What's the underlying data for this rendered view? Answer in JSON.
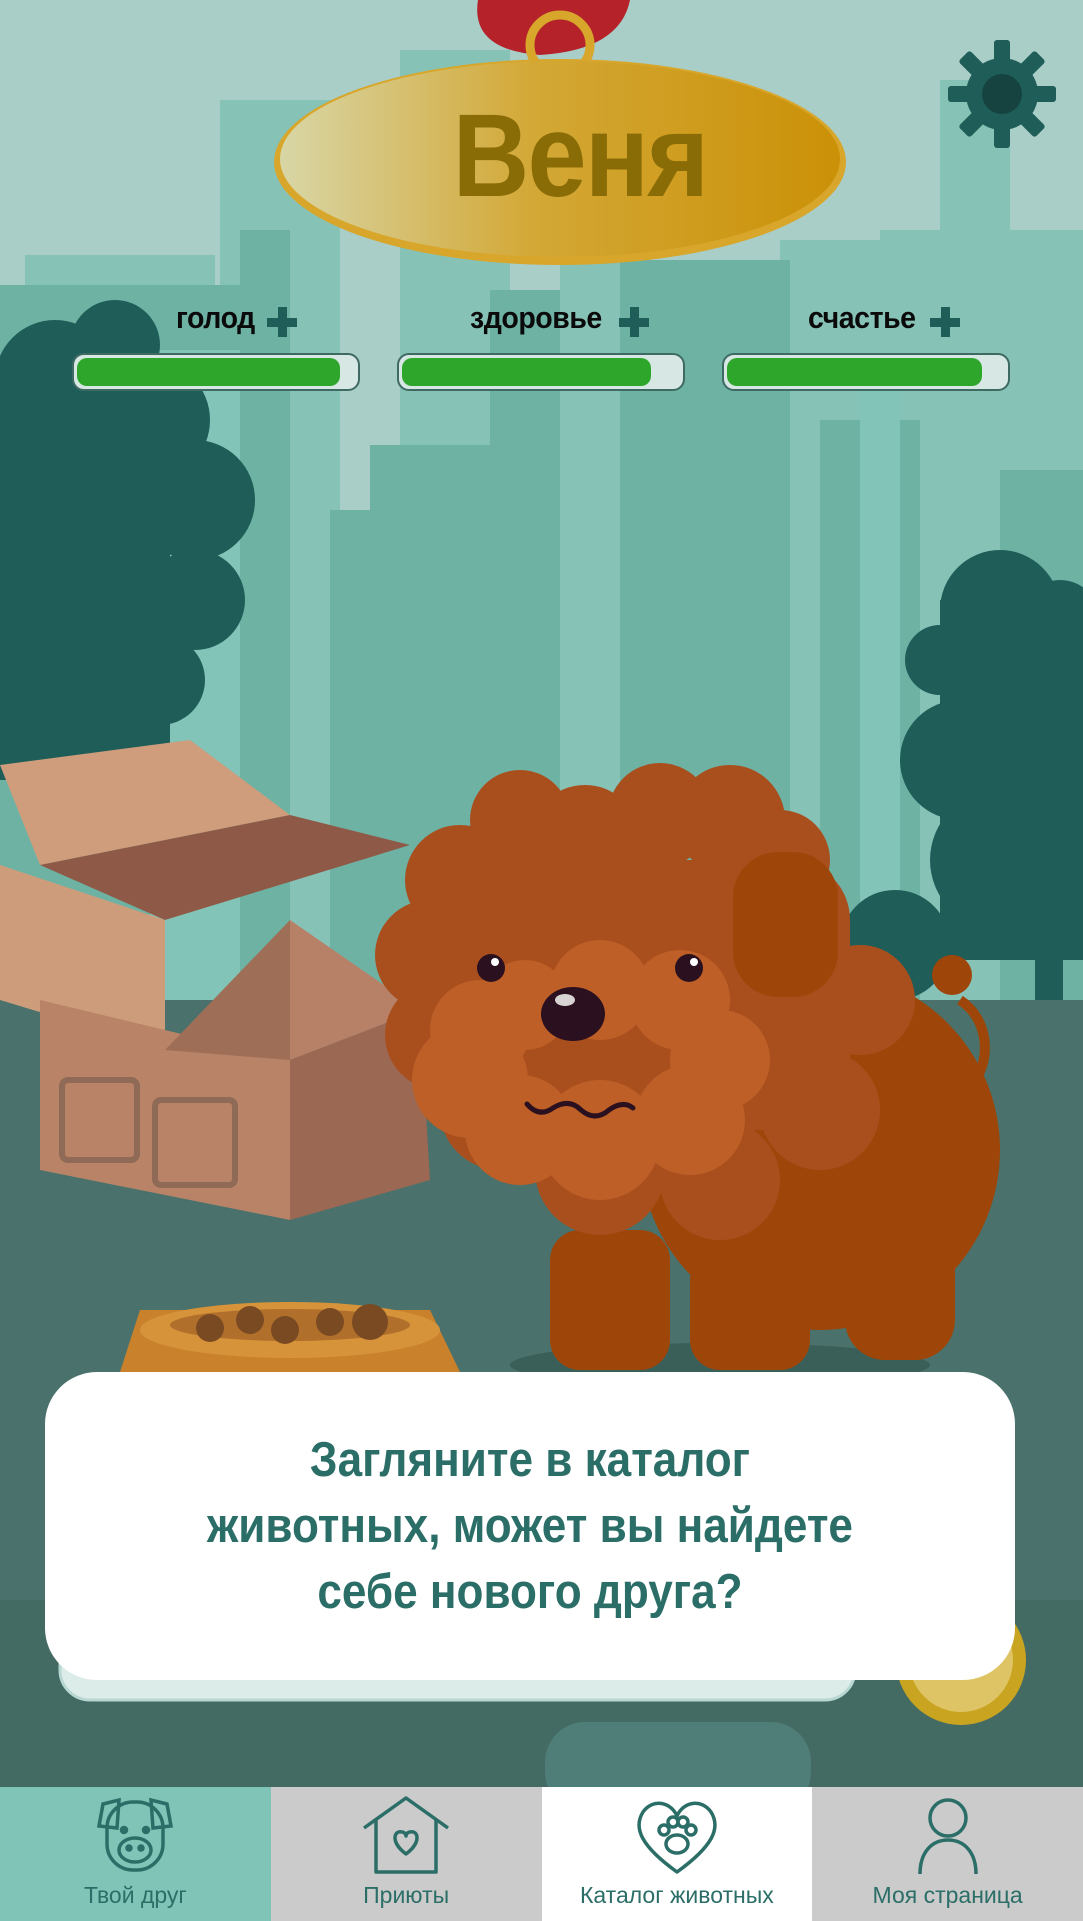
{
  "pet": {
    "name": "Веня"
  },
  "stats": [
    {
      "label": "голод",
      "level": 0.96
    },
    {
      "label": "здоровье",
      "level": 0.91
    },
    {
      "label": "счастье",
      "level": 0.93
    }
  ],
  "tip": {
    "text": "Загляните в каталог животных, может вы найдете себе нового друга?"
  },
  "nav": [
    {
      "label": "Твой друг",
      "icon": "dog-face-icon"
    },
    {
      "label": "Приюты",
      "icon": "house-heart-icon"
    },
    {
      "label": "Каталог животных",
      "icon": "heart-paw-icon"
    },
    {
      "label": "Моя страница",
      "icon": "person-icon"
    }
  ],
  "colors": {
    "accent": "#2b6e67",
    "progress": "#2ea62c",
    "name_tag": "#d4a21a",
    "nav_active_bg": "#ffffff",
    "nav_home_bg": "#80c3b7"
  }
}
